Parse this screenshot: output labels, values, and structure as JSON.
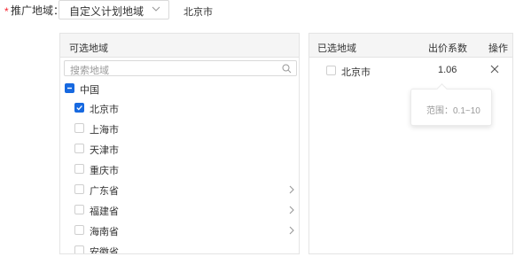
{
  "form": {
    "required_mark": "*",
    "label": "推广地域：",
    "select_value": "自定义计划地域",
    "region_summary": "北京市"
  },
  "available": {
    "header": "可选地域",
    "search_placeholder": "搜索地域",
    "root": {
      "label": "中国",
      "state": "partial"
    },
    "items": [
      {
        "label": "北京市",
        "checked": true,
        "expandable": false
      },
      {
        "label": "上海市",
        "checked": false,
        "expandable": false
      },
      {
        "label": "天津市",
        "checked": false,
        "expandable": false
      },
      {
        "label": "重庆市",
        "checked": false,
        "expandable": false
      },
      {
        "label": "广东省",
        "checked": false,
        "expandable": true
      },
      {
        "label": "福建省",
        "checked": false,
        "expandable": true
      },
      {
        "label": "海南省",
        "checked": false,
        "expandable": true
      },
      {
        "label": "安徽省",
        "checked": false,
        "expandable": false
      }
    ]
  },
  "selected": {
    "header_region": "已选地域",
    "header_coef": "出价系数",
    "header_action": "操作",
    "rows": [
      {
        "label": "北京市",
        "coef": "1.06"
      }
    ],
    "tooltip": "范围：0.1~10"
  },
  "colors": {
    "accent": "#1769e0",
    "required": "#f5222d"
  }
}
